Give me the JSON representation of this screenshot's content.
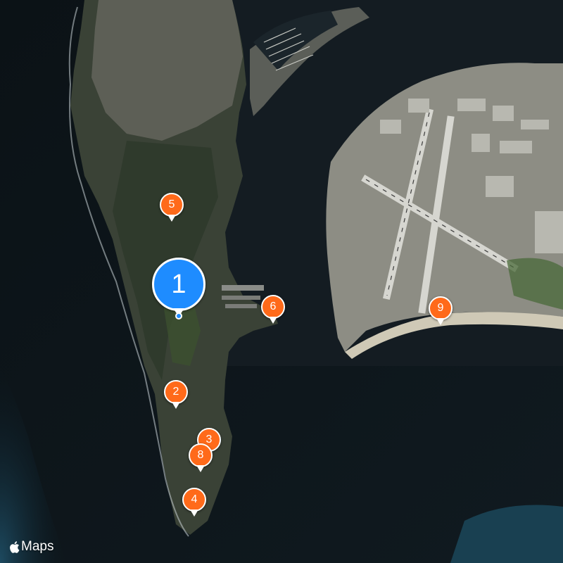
{
  "brand": {
    "label": "Maps",
    "icon": "apple-logo-icon"
  },
  "colors": {
    "primary_pin": "#1e8cff",
    "secondary_pin": "#ff6a1a",
    "water": "#0f1a22",
    "land": "#3e4438"
  },
  "markers": [
    {
      "label": "1",
      "kind": "primary"
    },
    {
      "label": "2",
      "kind": "secondary"
    },
    {
      "label": "3",
      "kind": "secondary"
    },
    {
      "label": "4",
      "kind": "secondary"
    },
    {
      "label": "5",
      "kind": "secondary"
    },
    {
      "label": "6",
      "kind": "secondary"
    },
    {
      "label": "8",
      "kind": "secondary"
    },
    {
      "label": "9",
      "kind": "secondary"
    }
  ]
}
